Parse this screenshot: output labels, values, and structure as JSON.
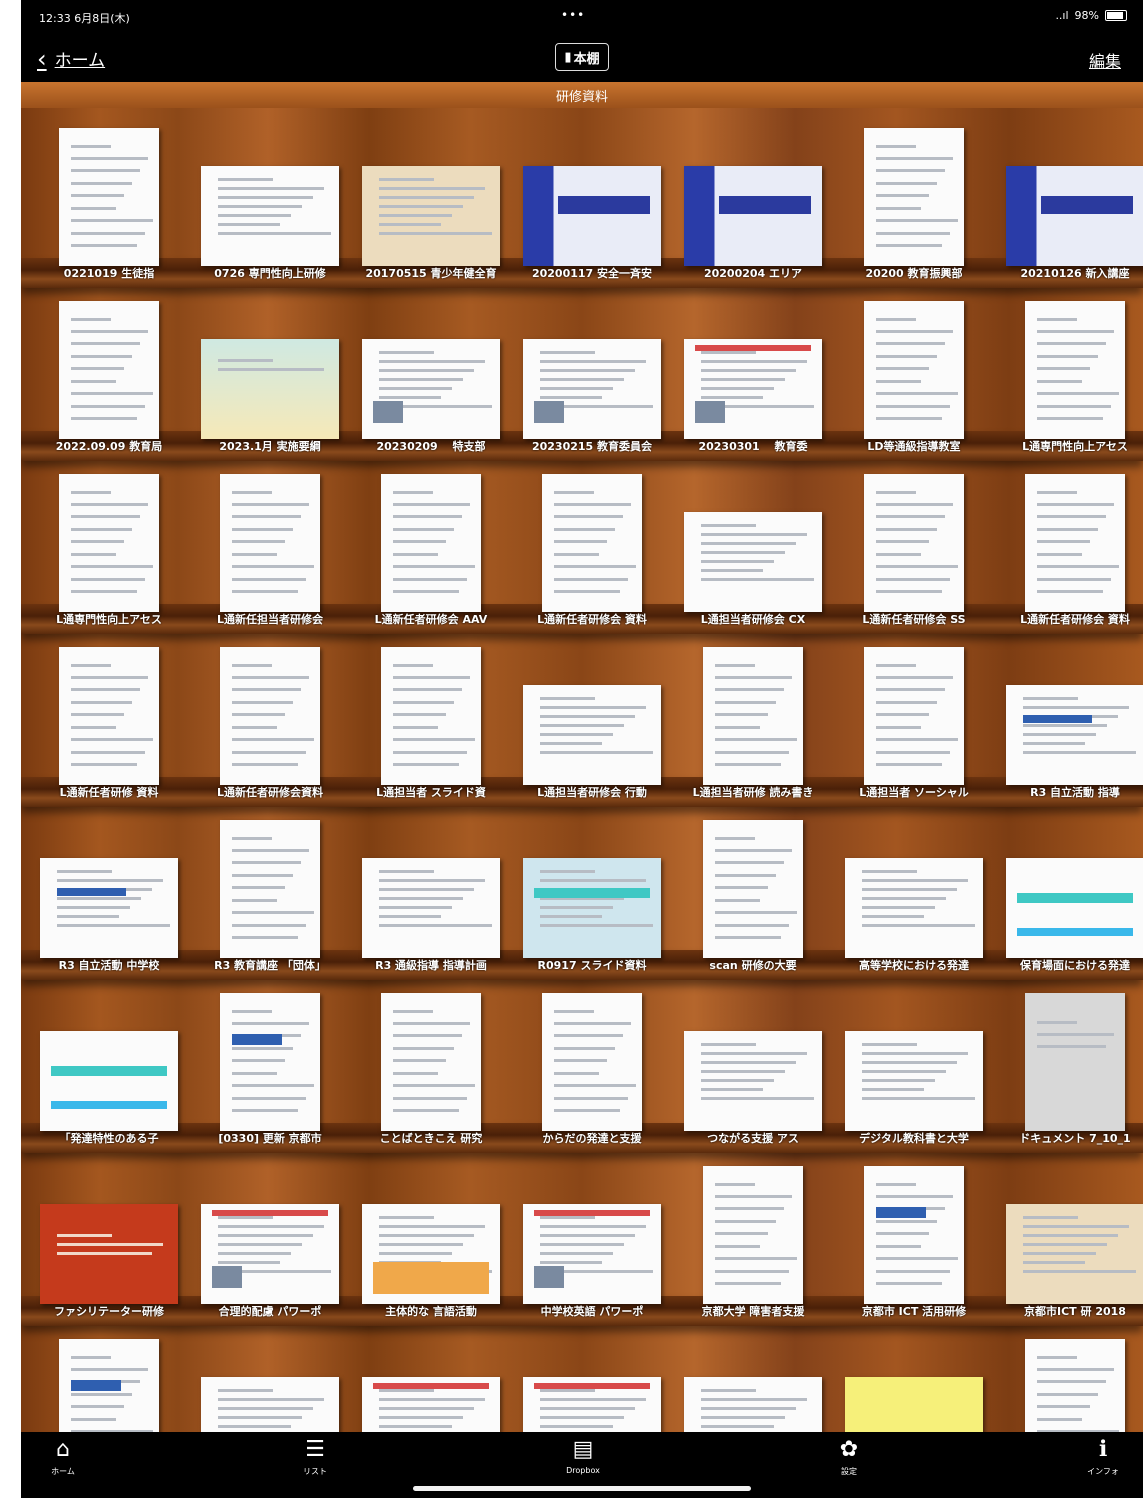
{
  "status_bar": {
    "time": "12:33",
    "date": "6月8日(木)",
    "dots": "•••",
    "signal": "..ıl",
    "battery_pct": "98%"
  },
  "nav": {
    "back_label": "ホーム",
    "title": "本棚",
    "edit_label": "編集"
  },
  "shelf": {
    "header": "研修資料",
    "rows": [
      {
        "books": [
          {
            "label": "0221019 生徒指",
            "cover": "doc",
            "dim": "port"
          },
          {
            "label": "0726 専門性向上研修",
            "cover": "doc",
            "dim": "land"
          },
          {
            "label": "20170515 青少年健全育",
            "cover": "tan",
            "dim": "land"
          },
          {
            "label": "20200117 安全一斉安",
            "cover": "slide-blue",
            "dim": "land"
          },
          {
            "label": "20200204 エリア",
            "cover": "slide-blue",
            "dim": "land"
          },
          {
            "label": "20200 教育振興部",
            "cover": "doc",
            "dim": "port"
          },
          {
            "label": "20210126 新入講座",
            "cover": "slide-blue",
            "dim": "land"
          }
        ]
      },
      {
        "books": [
          {
            "label": "2022.09.09 教育局",
            "cover": "doc",
            "dim": "port"
          },
          {
            "label": "2023.1月 実施要綱",
            "cover": "green",
            "dim": "land"
          },
          {
            "label": "20230209 　特支部",
            "cover": "doc-photo",
            "dim": "land"
          },
          {
            "label": "20230215 教育委員会",
            "cover": "doc-photo",
            "dim": "land"
          },
          {
            "label": "20230301 　教育委",
            "cover": "doc-red",
            "dim": "land"
          },
          {
            "label": "LD等通級指導教室",
            "cover": "doc",
            "dim": "port"
          },
          {
            "label": "L通専門性向上アセス",
            "cover": "doc",
            "dim": "port"
          }
        ]
      },
      {
        "books": [
          {
            "label": "L通専門性向上アセス",
            "cover": "doc",
            "dim": "port"
          },
          {
            "label": "L通新任担当者研修会",
            "cover": "doc",
            "dim": "port"
          },
          {
            "label": "L通新任者研修会 AAV",
            "cover": "doc",
            "dim": "port"
          },
          {
            "label": "L通新任者研修会 資料",
            "cover": "doc",
            "dim": "port"
          },
          {
            "label": "L通担当者研修会 CX",
            "cover": "doc",
            "dim": "land"
          },
          {
            "label": "L通新任者研修会 SS",
            "cover": "doc",
            "dim": "port"
          },
          {
            "label": "L通新任者研修会 資料",
            "cover": "doc",
            "dim": "port"
          }
        ]
      },
      {
        "books": [
          {
            "label": "L通新任者研修 資料",
            "cover": "doc",
            "dim": "port"
          },
          {
            "label": "L通新任者研修会資料",
            "cover": "doc",
            "dim": "port"
          },
          {
            "label": "L通担当者 スライド資",
            "cover": "doc",
            "dim": "port"
          },
          {
            "label": "L通担当者研修会 行動",
            "cover": "doc",
            "dim": "land"
          },
          {
            "label": "L通担当者研修 読み書き",
            "cover": "doc",
            "dim": "port"
          },
          {
            "label": "L通担当者 ソーシャル",
            "cover": "doc",
            "dim": "port"
          },
          {
            "label": "R3 自立活動 指導",
            "cover": "doc-blue",
            "dim": "land"
          }
        ]
      },
      {
        "books": [
          {
            "label": "R3 自立活動 中学校",
            "cover": "doc-blue",
            "dim": "land"
          },
          {
            "label": "R3 教育講座 「団体」",
            "cover": "doc",
            "dim": "port"
          },
          {
            "label": "R3 通級指導 指導計画",
            "cover": "doc",
            "dim": "land"
          },
          {
            "label": "R0917 スライド資料",
            "cover": "doc-cyan",
            "dim": "land"
          },
          {
            "label": "scan 研修の大要",
            "cover": "doc",
            "dim": "port"
          },
          {
            "label": "高等学校における発達",
            "cover": "doc",
            "dim": "land"
          },
          {
            "label": "保育場面における発達",
            "cover": "cyan",
            "dim": "land"
          }
        ]
      },
      {
        "books": [
          {
            "label": "「発達特性のある子",
            "cover": "cyan",
            "dim": "land"
          },
          {
            "label": "[0330] 更新 京都市",
            "cover": "doc-blue",
            "dim": "port"
          },
          {
            "label": "ことばときこえ 研究",
            "cover": "doc",
            "dim": "port"
          },
          {
            "label": "からだの発達と支援",
            "cover": "doc",
            "dim": "port"
          },
          {
            "label": "つながる支援 アス",
            "cover": "doc",
            "dim": "land"
          },
          {
            "label": "デジタル教科書と大学",
            "cover": "doc",
            "dim": "land"
          },
          {
            "label": "ドキュメント 7_10_1",
            "cover": "grey",
            "dim": "port"
          }
        ]
      },
      {
        "books": [
          {
            "label": "ファシリテーター研修",
            "cover": "red",
            "dim": "land"
          },
          {
            "label": "合理的配慮 パワーポ",
            "cover": "doc-red",
            "dim": "land"
          },
          {
            "label": "主体的な 言語活動",
            "cover": "doc-kids",
            "dim": "land"
          },
          {
            "label": "中学校英語 パワーポ",
            "cover": "doc-red",
            "dim": "land"
          },
          {
            "label": "京都大学 障害者支援",
            "cover": "doc",
            "dim": "port"
          },
          {
            "label": "京都市 ICT 活用研修",
            "cover": "doc-blue",
            "dim": "port"
          },
          {
            "label": "京都市ICT 研 2018",
            "cover": "tan",
            "dim": "land"
          }
        ]
      },
      {
        "books": [
          {
            "label": "",
            "cover": "doc-blue",
            "dim": "port"
          },
          {
            "label": "",
            "cover": "doc",
            "dim": "land"
          },
          {
            "label": "",
            "cover": "doc-red",
            "dim": "land"
          },
          {
            "label": "",
            "cover": "doc-red",
            "dim": "land"
          },
          {
            "label": "",
            "cover": "doc",
            "dim": "land"
          },
          {
            "label": "",
            "cover": "yellow",
            "dim": "land"
          },
          {
            "label": "",
            "cover": "doc",
            "dim": "port"
          }
        ]
      }
    ]
  },
  "tabs": [
    {
      "icon": "home-icon",
      "glyph": "⌂",
      "label": "ホーム"
    },
    {
      "icon": "list-icon",
      "glyph": "☰",
      "label": "リスト"
    },
    {
      "icon": "dropbox-icon",
      "glyph": "▤",
      "label": "Dropbox"
    },
    {
      "icon": "settings-icon",
      "glyph": "✿",
      "label": "設定"
    },
    {
      "icon": "info-icon",
      "glyph": "ℹ",
      "label": "インフォ"
    }
  ]
}
